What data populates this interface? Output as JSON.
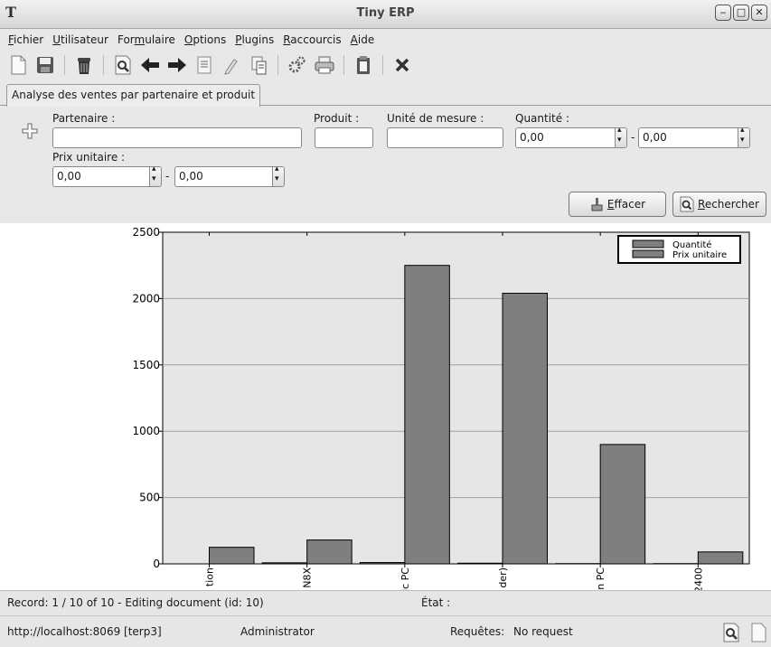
{
  "window": {
    "title": "Tiny ERP",
    "app_icon": "T",
    "buttons": [
      "minimize-icon",
      "maximize-icon",
      "close-icon"
    ]
  },
  "menu": [
    {
      "pre": "",
      "u": "F",
      "post": "ichier"
    },
    {
      "pre": "",
      "u": "U",
      "post": "tilisateur"
    },
    {
      "pre": "For",
      "u": "m",
      "post": "ulaire"
    },
    {
      "pre": "",
      "u": "O",
      "post": "ptions"
    },
    {
      "pre": "",
      "u": "P",
      "post": "lugins"
    },
    {
      "pre": "",
      "u": "R",
      "post": "accourcis"
    },
    {
      "pre": "",
      "u": "A",
      "post": "ide"
    }
  ],
  "toolbar": {
    "icons": [
      "new-icon",
      "save-icon",
      "delete-icon",
      "find-icon",
      "previous-icon",
      "next-icon",
      "form-view-icon",
      "reload-icon",
      "attachment-icon",
      "action-icon",
      "print-icon",
      "copy-icon",
      "close-tab-icon"
    ]
  },
  "tab": {
    "label": "Analyse des ventes par partenaire et produit"
  },
  "search": {
    "partenaire_label": "Partenaire :",
    "partenaire_value": "",
    "produit_label": "Produit :",
    "produit_value": "",
    "unite_label": "Unité de mesure :",
    "unite_value": "",
    "quantite_label": "Quantité :",
    "quantite_from": "0,00",
    "quantite_to": "0,00",
    "prix_label": "Prix unitaire :",
    "prix_from": "0,00",
    "prix_to": "0,00",
    "range_sep": "-",
    "clear_pre": "",
    "clear_u": "E",
    "clear_post": "ffacer",
    "search_pre": "",
    "search_u": "R",
    "search_post": "echercher"
  },
  "chart_data": {
    "type": "bar",
    "title": "",
    "xlabel": "",
    "ylabel": "",
    "ylim": [
      0,
      2500
    ],
    "yticks": [
      0,
      500,
      1000,
      1500,
      2000,
      2500
    ],
    "grid": true,
    "legend_position": "top-right",
    "categories": [
      "tion",
      "N8X",
      "ic PC",
      "der)",
      "n PC",
      "2400"
    ],
    "series": [
      {
        "name": "Quantité",
        "values": [
          0,
          8,
          10,
          5,
          2,
          2
        ]
      },
      {
        "name": "Prix unitaire",
        "values": [
          125,
          180,
          2250,
          2040,
          900,
          90
        ]
      }
    ],
    "colors": {
      "bar": "#7f7f7f",
      "plot_bg": "#e6e6e6"
    }
  },
  "status": {
    "record": "Record: 1 / 10 of 10 - Editing document (id: 10)",
    "etat_label": "État :",
    "etat_value": "",
    "server": "http://localhost:8069 [terp3]",
    "user": "Administrator",
    "requests_label": "Requêtes:",
    "requests_value": "No request"
  }
}
